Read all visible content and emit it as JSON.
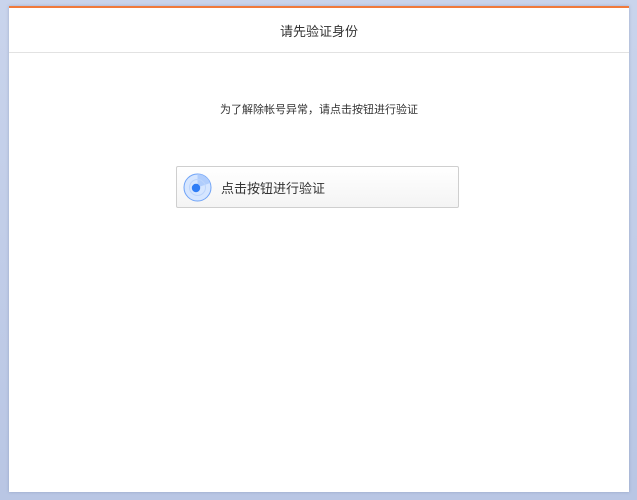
{
  "dialog": {
    "title": "请先验证身份",
    "notice": "为了解除帐号异常，请点击按钮进行验证",
    "verify_button": {
      "icon": "radar-icon",
      "label": "点击按钮进行验证"
    }
  },
  "colors": {
    "accent_top_border": "#f07a3c",
    "icon_blue": "#2f7df6",
    "backdrop": "#c3cfe9"
  }
}
